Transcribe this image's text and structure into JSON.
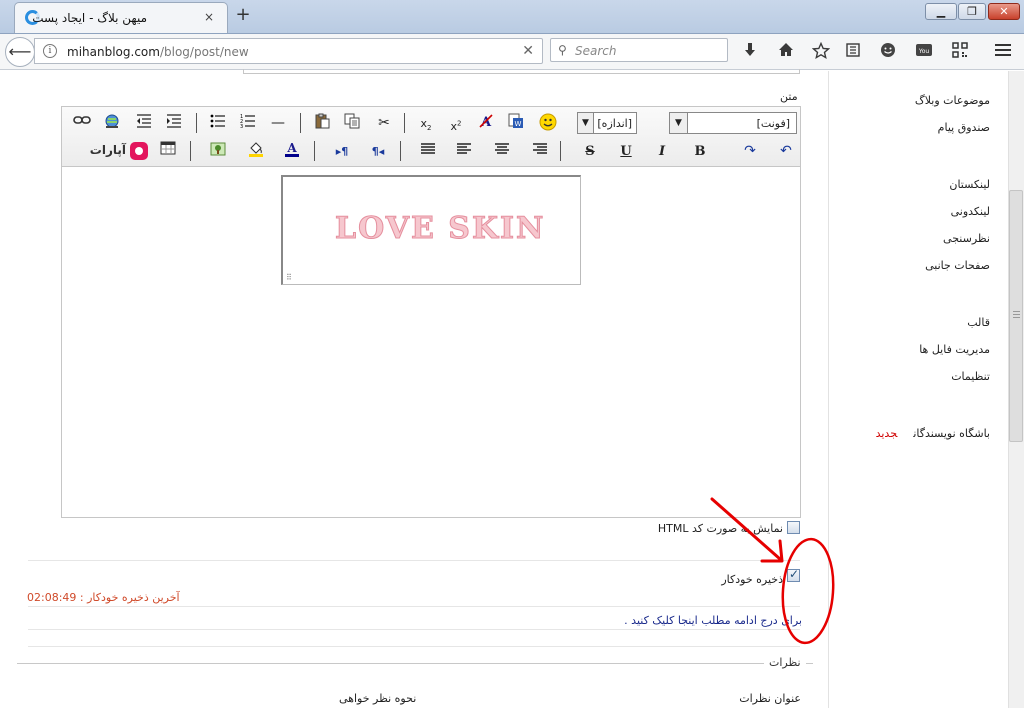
{
  "browser": {
    "tab_title": "میهن بلاگ - ایجاد پست",
    "tab_close": "×",
    "new_tab": "+",
    "url_host": "mihanblog.com",
    "url_path": "/blog/post/new",
    "search_placeholder": "Search",
    "window_buttons": {
      "minimize": "▁",
      "maximize": "❐",
      "close": "✕"
    }
  },
  "sidebar": {
    "items": [
      {
        "label": "موضوعات وبلاگ"
      },
      {
        "label": "صندوق پیام"
      },
      {
        "label": "لینکستان"
      },
      {
        "label": "لینکدونی"
      },
      {
        "label": "نظرسنجی"
      },
      {
        "label": "صفحات جانبی"
      },
      {
        "label": "قالب"
      },
      {
        "label": "مدیریت فایل ها"
      },
      {
        "label": "تنظیمات"
      },
      {
        "label": "باشگاه نویسندگان",
        "badge": "جدید"
      }
    ]
  },
  "editor": {
    "body_label": "متن",
    "font_select": "[فونت]",
    "size_select": "[اندازه]",
    "aparat_label": "آپارات",
    "watermark_text": "LOVE SKIN",
    "toolbar_colors": {
      "font_color": "#00008b",
      "highlight": "#ffd400"
    }
  },
  "options": {
    "html_mode_label": "نمایش به صورت کد HTML",
    "html_mode_checked": false,
    "autosave_label": "ذخیره خودکار",
    "autosave_checked": true,
    "last_autosave": "آخرین ذخیره خودکار : 02:08:49",
    "more_link": "برای درج ادامه مطلب اینجا کلیک کنید ."
  },
  "comments": {
    "legend": "نظرات",
    "title_label": "عنوان نظرات",
    "mode_label": "نحوه نظر خواهی"
  },
  "colors": {
    "accent_red": "#e60000",
    "link_blue": "#1a2a8c",
    "timestamp_red": "#d04a2a"
  }
}
